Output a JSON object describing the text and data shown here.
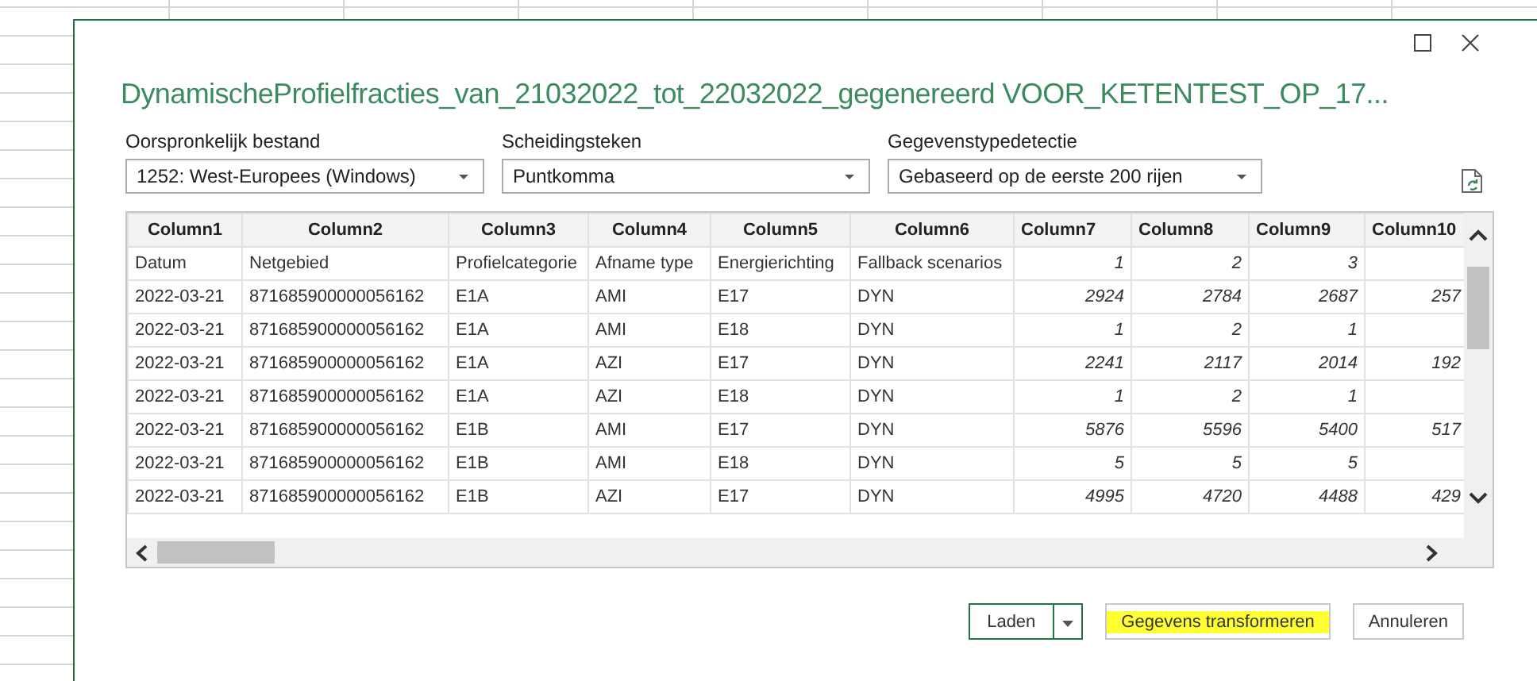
{
  "window": {
    "title": "DynamischeProfielfracties_van_21032022_tot_22032022_gegenereerd VOOR_KETENTEST_OP_17..."
  },
  "options": [
    {
      "label": "Oorspronkelijk bestand",
      "value": "1252: West-Europees (Windows)"
    },
    {
      "label": "Scheidingsteken",
      "value": "Puntkomma"
    },
    {
      "label": "Gegevenstypedetectie",
      "value": "Gebaseerd op de eerste 200 rijen"
    }
  ],
  "table": {
    "columns": [
      {
        "label": "Column1",
        "kind": "text"
      },
      {
        "label": "Column2",
        "kind": "text"
      },
      {
        "label": "Column3",
        "kind": "text"
      },
      {
        "label": "Column4",
        "kind": "text"
      },
      {
        "label": "Column5",
        "kind": "text"
      },
      {
        "label": "Column6",
        "kind": "text"
      },
      {
        "label": "Column7",
        "kind": "number"
      },
      {
        "label": "Column8",
        "kind": "number"
      },
      {
        "label": "Column9",
        "kind": "number"
      },
      {
        "label": "Column10",
        "kind": "number"
      }
    ],
    "rows": [
      [
        "Datum",
        "Netgebied",
        "Profielcategorie",
        "Afname type",
        "Energierichting",
        "Fallback scenarios",
        "1",
        "2",
        "3",
        null
      ],
      [
        "2022-03-21",
        "871685900000056162",
        "E1A",
        "AMI",
        "E17",
        "DYN",
        "2924",
        "2784",
        "2687",
        "257"
      ],
      [
        "2022-03-21",
        "871685900000056162",
        "E1A",
        "AMI",
        "E18",
        "DYN",
        "1",
        "2",
        "1",
        null
      ],
      [
        "2022-03-21",
        "871685900000056162",
        "E1A",
        "AZI",
        "E17",
        "DYN",
        "2241",
        "2117",
        "2014",
        "192"
      ],
      [
        "2022-03-21",
        "871685900000056162",
        "E1A",
        "AZI",
        "E18",
        "DYN",
        "1",
        "2",
        "1",
        null
      ],
      [
        "2022-03-21",
        "871685900000056162",
        "E1B",
        "AMI",
        "E17",
        "DYN",
        "5876",
        "5596",
        "5400",
        "517"
      ],
      [
        "2022-03-21",
        "871685900000056162",
        "E1B",
        "AMI",
        "E18",
        "DYN",
        "5",
        "5",
        "5",
        null
      ],
      [
        "2022-03-21",
        "871685900000056162",
        "E1B",
        "AZI",
        "E17",
        "DYN",
        "4995",
        "4720",
        "4488",
        "429"
      ]
    ]
  },
  "buttons": [
    {
      "label": "Laden",
      "kind": "split",
      "highlighted": false
    },
    {
      "label": "Gegevens transformeren",
      "kind": "plain",
      "highlighted": true
    },
    {
      "label": "Annuleren",
      "kind": "plain",
      "highlighted": false
    }
  ]
}
